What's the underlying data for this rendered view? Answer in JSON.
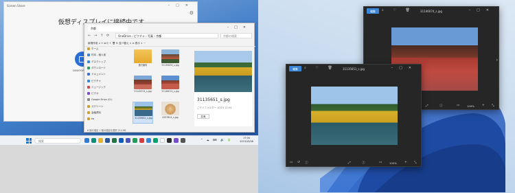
{
  "screen_share": {
    "title": "Screen Share",
    "heading": "仮想ディスプレイに接続中です",
    "subtitle": "表示が安定しない場合…",
    "device_label": "DESKTOP-J KOMY"
  },
  "explorer": {
    "tab_label": "京都",
    "path": "OneDrive › ピクチャ › 写真 › 京都",
    "search_placeholder": "京都の検索",
    "command_bar": "新規作成 ∨    ✂  ⧉  ⎘  ⇪  🗑   ⇅ 並べ替え ∨   ≡ 表示 ∨   ···",
    "nav_items": [
      {
        "label": "ホーム",
        "color": "#d0a030"
      },
      {
        "label": "村本 - 個人用",
        "color": "#3a86d8"
      },
      {
        "label": "デスクトップ",
        "color": "#3a86d8"
      },
      {
        "label": "ダウンロード",
        "color": "#2a9d5b"
      },
      {
        "label": "ドキュメント",
        "color": "#3a6fd6"
      },
      {
        "label": "ピクチャ",
        "color": "#3a86d8"
      },
      {
        "label": "ミュージック",
        "color": "#d04a4a"
      },
      {
        "label": "ビデオ",
        "color": "#7a4ad0"
      },
      {
        "label": "Google Drive (G:)",
        "color": "#888"
      },
      {
        "label": "スクリーン",
        "color": "#d0a030"
      },
      {
        "label": "会議資料",
        "color": "#d0a030"
      },
      {
        "label": "tw",
        "color": "#d0a030"
      }
    ],
    "files": [
      {
        "name": "旅行案内"
      },
      {
        "name": "31135835_s.jpg"
      },
      {
        "name": "31145374_s.jpg"
      },
      {
        "name": "31146074_s.jpg"
      },
      {
        "name": "31135651_s.jpg"
      },
      {
        "name": "4257824_s.jpg"
      }
    ],
    "preview_name": "31135651_s.jpg",
    "preview_date": "ごモドフォルダー 10/21 12:04",
    "preview_button": "共有",
    "status": "6 個の項目  1 個の項目を選択  214 KB"
  },
  "taskbar": {
    "search_placeholder": "検索",
    "tray": "^ ☁ ⌨ 🔊 🔋",
    "time": "17:04",
    "date": "2023/12/08"
  },
  "viewer_back": {
    "title": "31146074_s.jpg",
    "edit_label": "編集",
    "tools": "⌕ ♡ 🗑",
    "zoom": "100%"
  },
  "viewer_front": {
    "title": "31135651_s.jpg",
    "edit_label": "編集",
    "tools": "⌕ ♡ 🗑",
    "zoom": "100%"
  },
  "colors": {
    "accent": "#3a86d8",
    "viewer_bg": "#262626"
  }
}
